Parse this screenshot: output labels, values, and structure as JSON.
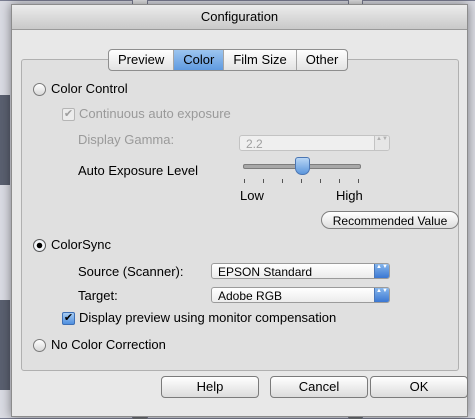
{
  "window": {
    "title": "Configuration"
  },
  "tabs": [
    {
      "label": "Preview",
      "active": false
    },
    {
      "label": "Color",
      "active": true
    },
    {
      "label": "Film Size",
      "active": false
    },
    {
      "label": "Other",
      "active": false
    }
  ],
  "color_control": {
    "label": "Color Control",
    "selected": false,
    "continuous_auto_exposure": {
      "label": "Continuous auto exposure",
      "checked": true,
      "enabled": false
    },
    "display_gamma": {
      "label": "Display Gamma:",
      "value": "2.2",
      "enabled": false
    },
    "auto_exposure_level": {
      "label": "Auto Exposure Level",
      "min_label": "Low",
      "max_label": "High",
      "level": 0.5
    },
    "recommended_button": "Recommended Value"
  },
  "colorsync": {
    "label": "ColorSync",
    "selected": true,
    "source": {
      "label": "Source (Scanner):",
      "value": "EPSON Standard"
    },
    "target": {
      "label": "Target:",
      "value": "Adobe RGB"
    },
    "display_preview": {
      "label": "Display preview using monitor compensation",
      "checked": true
    }
  },
  "no_color_correction": {
    "label": "No Color Correction",
    "selected": false
  },
  "buttons": {
    "help": "Help",
    "cancel": "Cancel",
    "ok": "OK"
  },
  "colors": {
    "accent": "#5f9ae0",
    "window_bg": "#e8e8e8"
  },
  "icons": {
    "checkmark": "✔",
    "popup_arrows": "▲▼"
  }
}
